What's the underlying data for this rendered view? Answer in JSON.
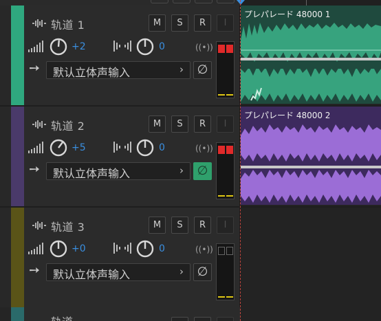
{
  "colors": {
    "track1": "#2fa87f",
    "track2": "#4a3a6a",
    "track3": "#5a5418",
    "track4": "#2a6a6a",
    "clip1": "#37a37e",
    "clip2": "#9b6dd6",
    "clip_red": "#e02a2a",
    "meter_level": "#e0c814",
    "accent": "#3a8fe0"
  },
  "buttons": {
    "mute": "M",
    "solo": "S",
    "record": "R",
    "input": "I",
    "monitor": "∅",
    "chevron": "›",
    "arrow": "➙",
    "rec_icon": "((•))"
  },
  "tracks": [
    {
      "name": "轨道 1",
      "volume": "+2",
      "pan": "0",
      "input": "默认立体声输入",
      "monitor_on": false,
      "clip_title": "プレパレード 48000 1",
      "clip_color": "#37a37e"
    },
    {
      "name": "轨道 2",
      "volume": "+5",
      "pan": "0",
      "input": "默认立体声输入",
      "monitor_on": true,
      "clip_title": "プレパレード 48000 2",
      "clip_color": "#9b6dd6"
    },
    {
      "name": "轨道 3",
      "volume": "+0",
      "pan": "0",
      "input": "默认立体声输入",
      "monitor_on": false,
      "clip_title": "",
      "clip_color": ""
    }
  ],
  "partial_track": {
    "name": "轨道"
  }
}
